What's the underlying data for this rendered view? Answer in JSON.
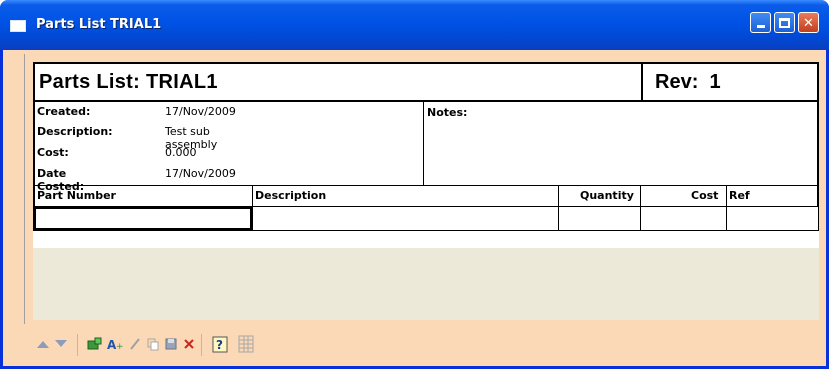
{
  "window": {
    "title": "Parts List TRIAL1",
    "controls": [
      "minimize",
      "maximize",
      "close"
    ]
  },
  "report": {
    "title": "Parts List: TRIAL1",
    "rev_label": "Rev:",
    "rev_value": "1",
    "info": [
      {
        "label": "Created:",
        "value": "17/Nov/2009"
      },
      {
        "label": "Description:",
        "value": "Test sub assembly"
      },
      {
        "label": "Cost:",
        "value": "0.000"
      },
      {
        "label": "Date Costed:",
        "value": "17/Nov/2009"
      }
    ],
    "notes_label": "Notes:",
    "columns": [
      "Part Number",
      "Description",
      "Quantity",
      "Cost",
      "Ref"
    ]
  },
  "toolbar": {
    "icons": [
      "move-up-icon",
      "move-down-icon",
      "add-part-icon",
      "add-text-icon",
      "edit-icon",
      "copy-icon",
      "save-icon",
      "delete-icon",
      "help-icon",
      "grid-icon"
    ]
  },
  "colors": {
    "titlebar": "#0052e6",
    "window_body": "#fcd9b6",
    "gray_area": "#ece9d8",
    "close_button": "#c2401d"
  }
}
